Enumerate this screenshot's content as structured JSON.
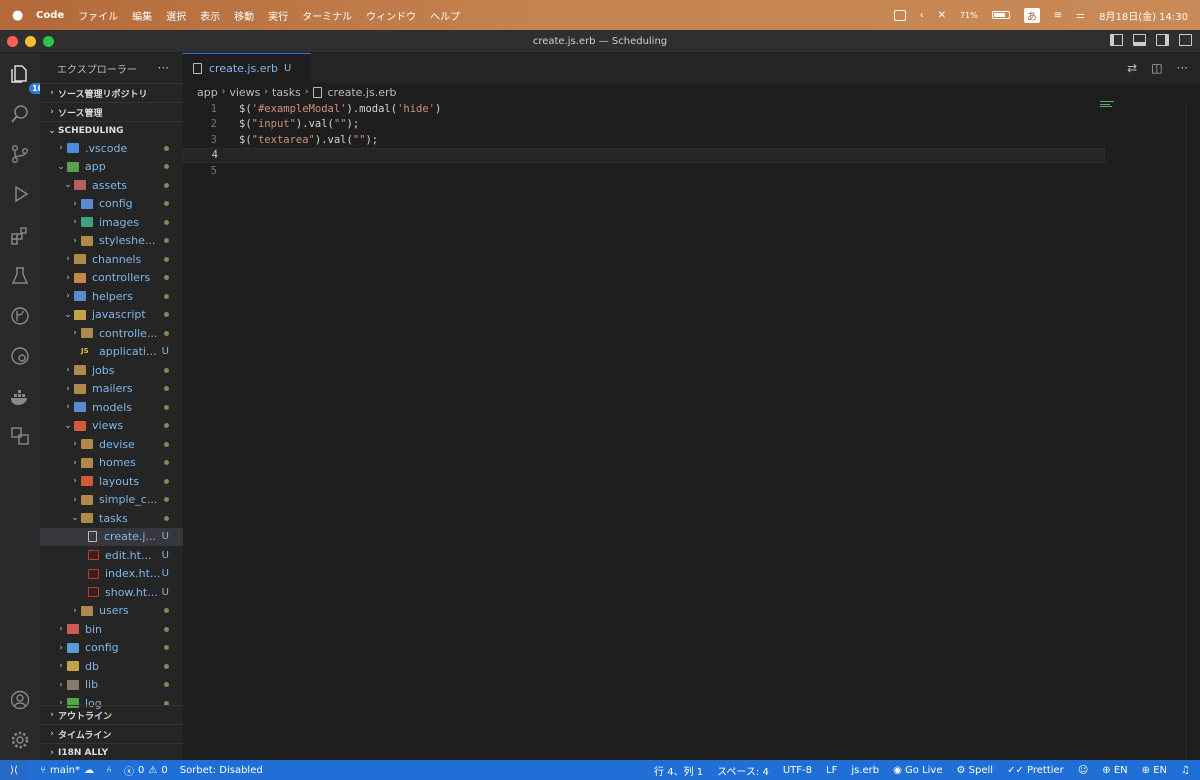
{
  "menubar": {
    "app_name": "Code",
    "items": [
      "ファイル",
      "編集",
      "選択",
      "表示",
      "移動",
      "実行",
      "ターミナル",
      "ウィンドウ",
      "ヘルプ"
    ],
    "battery": "71%",
    "input_method": "あ",
    "datetime": "8月18日(金)  14:30"
  },
  "window": {
    "title": "create.js.erb — Scheduling"
  },
  "activity_bar": {
    "explorer_badge": "108",
    "icons": [
      "files-icon",
      "search-icon",
      "source-control-icon",
      "run-debug-icon",
      "extensions-icon",
      "testing-icon",
      "git-graph-icon",
      "remote-explorer-icon",
      "docker-icon",
      "i18n-icon",
      "account-icon",
      "settings-gear-icon"
    ]
  },
  "sidebar": {
    "title": "エクスプローラー",
    "more": "···",
    "sections_top": [
      "ソース管理リポジトリ",
      "ソース管理"
    ],
    "project": "SCHEDULING",
    "tree": [
      {
        "label": ".vscode",
        "depth": 1,
        "kind": "folder",
        "open": false,
        "color": "#4c8ae0",
        "status": "dot"
      },
      {
        "label": "app",
        "depth": 1,
        "kind": "folder",
        "open": true,
        "color": "#56a24a",
        "status": "dot"
      },
      {
        "label": "assets",
        "depth": 2,
        "kind": "folder",
        "open": true,
        "color": "#b46060",
        "status": "dot"
      },
      {
        "label": "config",
        "depth": 3,
        "kind": "folder",
        "open": false,
        "color": "#5b8bd4",
        "status": "dot"
      },
      {
        "label": "images",
        "depth": 3,
        "kind": "folder",
        "open": false,
        "color": "#3fa37f",
        "status": "dot"
      },
      {
        "label": "styleshe...",
        "depth": 3,
        "kind": "folder",
        "open": false,
        "color": "#b08a4a",
        "status": "dot"
      },
      {
        "label": "channels",
        "depth": 2,
        "kind": "folder",
        "open": false,
        "color": "#b08a4a",
        "status": "dot"
      },
      {
        "label": "controllers",
        "depth": 2,
        "kind": "folder",
        "open": false,
        "color": "#c48a4a",
        "status": "dot"
      },
      {
        "label": "helpers",
        "depth": 2,
        "kind": "folder",
        "open": false,
        "color": "#5b8bd4",
        "status": "dot"
      },
      {
        "label": "javascript",
        "depth": 2,
        "kind": "folder",
        "open": true,
        "color": "#c4a24a",
        "status": "dot"
      },
      {
        "label": "controlle...",
        "depth": 3,
        "kind": "folder",
        "open": false,
        "color": "#b08a4a",
        "status": "dot"
      },
      {
        "label": "applicati...",
        "depth": 3,
        "kind": "js",
        "open": null,
        "color": "#e2c23b",
        "status": "U"
      },
      {
        "label": "jobs",
        "depth": 2,
        "kind": "folder",
        "open": false,
        "color": "#b08a4a",
        "status": "dot"
      },
      {
        "label": "mailers",
        "depth": 2,
        "kind": "folder",
        "open": false,
        "color": "#b08a4a",
        "status": "dot"
      },
      {
        "label": "models",
        "depth": 2,
        "kind": "folder",
        "open": false,
        "color": "#5b8bd4",
        "status": "dot"
      },
      {
        "label": "views",
        "depth": 2,
        "kind": "folder",
        "open": true,
        "color": "#d05a3a",
        "status": "dot"
      },
      {
        "label": "devise",
        "depth": 3,
        "kind": "folder",
        "open": false,
        "color": "#b08a4a",
        "status": "dot"
      },
      {
        "label": "homes",
        "depth": 3,
        "kind": "folder",
        "open": false,
        "color": "#b08a4a",
        "status": "dot"
      },
      {
        "label": "layouts",
        "depth": 3,
        "kind": "folder",
        "open": false,
        "color": "#d05a3a",
        "status": "dot"
      },
      {
        "label": "simple_c...",
        "depth": 3,
        "kind": "folder",
        "open": false,
        "color": "#b08a4a",
        "status": "dot"
      },
      {
        "label": "tasks",
        "depth": 3,
        "kind": "folder",
        "open": true,
        "color": "#b08a4a",
        "status": "dot"
      },
      {
        "label": "create.j...",
        "depth": 4,
        "kind": "file",
        "open": null,
        "color": "#bbbbbb",
        "status": "U",
        "selected": true
      },
      {
        "label": "edit.ht...",
        "depth": 4,
        "kind": "html",
        "open": null,
        "color": "#c0392b",
        "status": "U"
      },
      {
        "label": "index.ht...",
        "depth": 4,
        "kind": "html",
        "open": null,
        "color": "#c0392b",
        "status": "U"
      },
      {
        "label": "show.ht...",
        "depth": 4,
        "kind": "html",
        "open": null,
        "color": "#c0392b",
        "status": "U"
      },
      {
        "label": "users",
        "depth": 3,
        "kind": "folder",
        "open": false,
        "color": "#b08a4a",
        "status": "dot"
      },
      {
        "label": "bin",
        "depth": 1,
        "kind": "folder",
        "open": false,
        "color": "#d05a5a",
        "status": "dot"
      },
      {
        "label": "config",
        "depth": 1,
        "kind": "folder",
        "open": false,
        "color": "#5b9bd4",
        "status": "dot"
      },
      {
        "label": "db",
        "depth": 1,
        "kind": "folder",
        "open": false,
        "color": "#c4a24a",
        "status": "dot"
      },
      {
        "label": "lib",
        "depth": 1,
        "kind": "folder",
        "open": false,
        "color": "#8a7a6a",
        "status": "dot"
      },
      {
        "label": "log",
        "depth": 1,
        "kind": "folder",
        "open": false,
        "color": "#56a24a",
        "status": "dot"
      }
    ],
    "sections_bottom": [
      "アウトライン",
      "タイムライン",
      "I18N ALLY"
    ]
  },
  "editor": {
    "tab": {
      "label": "create.js.erb",
      "status": "U"
    },
    "breadcrumb": [
      "app",
      "views",
      "tasks",
      "create.js.erb"
    ],
    "lines": [
      {
        "n": "1",
        "parts": [
          [
            "p",
            "$("
          ],
          [
            "s",
            "'#exampleModal'"
          ],
          [
            "p",
            ").modal("
          ],
          [
            "s",
            "'hide'"
          ],
          [
            "p",
            ")"
          ]
        ]
      },
      {
        "n": "2",
        "parts": [
          [
            "p",
            "$("
          ],
          [
            "s",
            "\"input\""
          ],
          [
            "p",
            ").val("
          ],
          [
            "s",
            "\"\""
          ],
          [
            "p",
            ");"
          ]
        ]
      },
      {
        "n": "3",
        "parts": [
          [
            "p",
            "$("
          ],
          [
            "s",
            "\"textarea\""
          ],
          [
            "p",
            ").val("
          ],
          [
            "s",
            "\"\""
          ],
          [
            "p",
            ");"
          ]
        ]
      },
      {
        "n": "4",
        "parts": [],
        "current": true
      },
      {
        "n": "5",
        "parts": []
      }
    ]
  },
  "statusbar": {
    "branch": "main*",
    "errors": "0",
    "warnings": "0",
    "sorbet": "Sorbet: Disabled",
    "position": "行 4、列 1",
    "spaces": "スペース: 4",
    "encoding": "UTF-8",
    "eol": "LF",
    "language": "js.erb",
    "golive": "Go Live",
    "spell": "Spell",
    "prettier": "Prettier",
    "lang1": "EN",
    "lang2": "EN"
  }
}
